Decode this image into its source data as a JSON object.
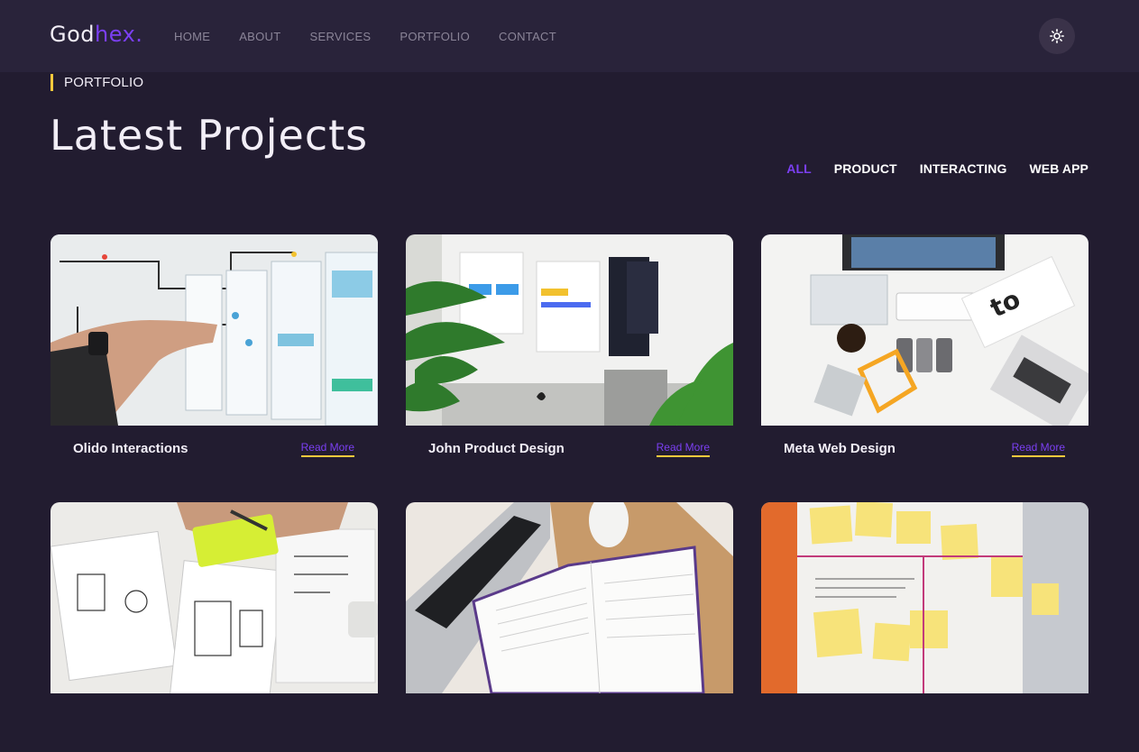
{
  "nav": {
    "logo_main": "God",
    "logo_accent": "hex",
    "logo_dot": ".",
    "links": [
      "HOME",
      "ABOUT",
      "SERVICES",
      "PORTFOLIO",
      "CONTACT"
    ]
  },
  "section": {
    "label": "PORTFOLIO",
    "title": "Latest Projects"
  },
  "filters": [
    "ALL",
    "PRODUCT",
    "INTERACTING",
    "WEB APP"
  ],
  "projects": [
    {
      "title": "Olido Interactions",
      "read_more": "Read More"
    },
    {
      "title": "John Product Design",
      "read_more": "Read More"
    },
    {
      "title": "Meta Web Design",
      "read_more": "Read More"
    },
    {
      "title": "",
      "read_more": ""
    },
    {
      "title": "",
      "read_more": ""
    },
    {
      "title": "",
      "read_more": ""
    }
  ],
  "colors": {
    "background": "#221c30",
    "navbar": "#29233a",
    "accent": "#7b3ff2",
    "highlight": "#ffc93c"
  },
  "icons": {
    "theme_toggle": "sun-icon"
  }
}
